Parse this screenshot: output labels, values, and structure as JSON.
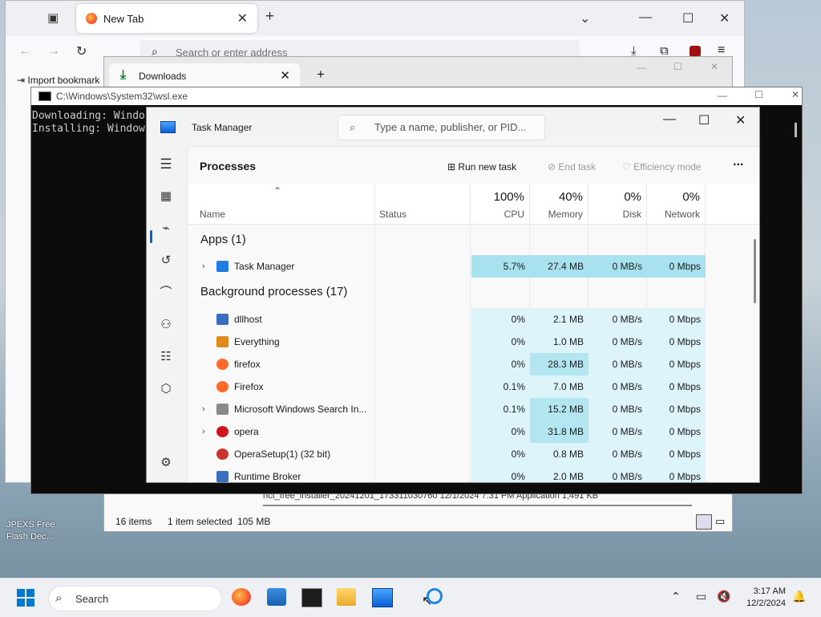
{
  "desktop": {
    "icon_label": "JPEXS Free\nFlash Dec..."
  },
  "firefox": {
    "tab_label": "New Tab",
    "address_placeholder": "Search or enter address",
    "bookmark": "Import bookmark"
  },
  "downloads": {
    "tab_label": "Downloads",
    "status_items": "16 items",
    "status_selected": "1 item selected",
    "status_size": "105 MB",
    "file_row": "nct_free_installer_20241201_173311030760       12/1/2024 7:31 PM         Application          1,491 KB"
  },
  "console": {
    "title": "C:\\Windows\\System32\\wsl.exe",
    "lines": "Downloading: Windo\nInstalling: Window"
  },
  "taskmanager": {
    "title": "Task Manager",
    "search_placeholder": "Type a name, publisher, or PID...",
    "page_title": "Processes",
    "toolbar": {
      "run": "Run new task",
      "end": "End task",
      "efficiency": "Efficiency mode",
      "more": "..."
    },
    "columns": {
      "name": "Name",
      "status": "Status",
      "cpu_pct": "100%",
      "cpu": "CPU",
      "mem_pct": "40%",
      "mem": "Memory",
      "disk_pct": "0%",
      "disk": "Disk",
      "net_pct": "0%",
      "net": "Network"
    },
    "groups": {
      "apps": "Apps (1)",
      "background": "Background processes (17)"
    },
    "apps": [
      {
        "name": "Task Manager",
        "cpu": "5.7%",
        "mem": "27.4 MB",
        "disk": "0 MB/s",
        "net": "0 Mbps"
      }
    ],
    "background": [
      {
        "name": "dllhost",
        "cpu": "0%",
        "mem": "2.1 MB",
        "disk": "0 MB/s",
        "net": "0 Mbps"
      },
      {
        "name": "Everything",
        "cpu": "0%",
        "mem": "1.0 MB",
        "disk": "0 MB/s",
        "net": "0 Mbps"
      },
      {
        "name": "firefox",
        "cpu": "0%",
        "mem": "28.3 MB",
        "disk": "0 MB/s",
        "net": "0 Mbps"
      },
      {
        "name": "Firefox",
        "cpu": "0.1%",
        "mem": "7.0 MB",
        "disk": "0 MB/s",
        "net": "0 Mbps"
      },
      {
        "name": "Microsoft Windows Search In...",
        "cpu": "0.1%",
        "mem": "15.2 MB",
        "disk": "0 MB/s",
        "net": "0 Mbps"
      },
      {
        "name": "opera",
        "cpu": "0%",
        "mem": "31.8 MB",
        "disk": "0 MB/s",
        "net": "0 Mbps"
      },
      {
        "name": "OperaSetup(1) (32 bit)",
        "cpu": "0%",
        "mem": "0.8 MB",
        "disk": "0 MB/s",
        "net": "0 Mbps"
      },
      {
        "name": "Runtime Broker",
        "cpu": "0%",
        "mem": "2.0 MB",
        "disk": "0 MB/s",
        "net": "0 Mbps"
      }
    ]
  },
  "taskbar": {
    "search_label": "Search",
    "time": "3:17 AM",
    "date": "12/2/2024"
  }
}
